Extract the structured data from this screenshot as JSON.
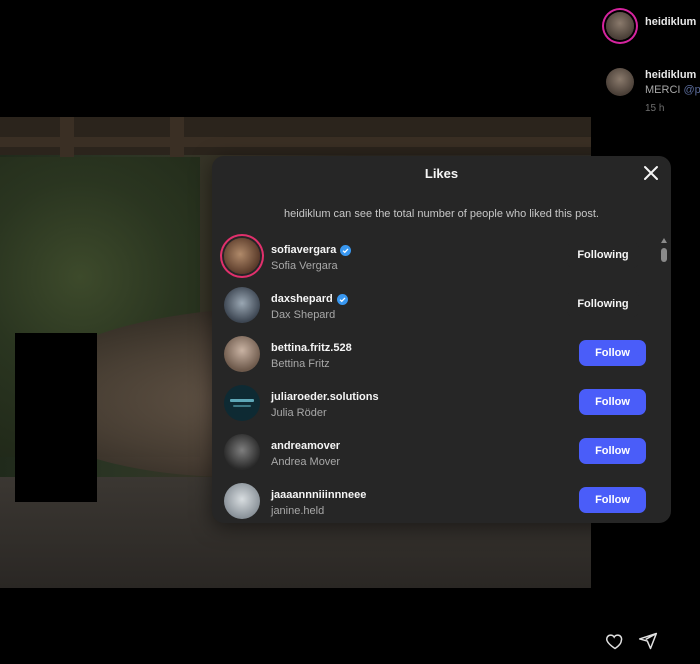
{
  "sidebar": {
    "top_username": "heidiklum",
    "comment_username": "heidiklum",
    "comment_text": "MERCI ",
    "comment_mention": "@p",
    "comment_time": "15 h",
    "icons": [
      "heart-icon",
      "share-icon"
    ]
  },
  "modal": {
    "title": "Likes",
    "notice": "heidiklum can see the total number of people who liked this post.",
    "users": [
      {
        "username": "sofiavergara",
        "fullname": "Sofia Vergara",
        "verified": true,
        "button": "Following",
        "story": true
      },
      {
        "username": "daxshepard",
        "fullname": "Dax Shepard",
        "verified": true,
        "button": "Following",
        "story": false
      },
      {
        "username": "bettina.fritz.528",
        "fullname": "Bettina Fritz",
        "verified": false,
        "button": "Follow",
        "story": false
      },
      {
        "username": "juliaroeder.solutions",
        "fullname": "Julia Röder",
        "verified": false,
        "button": "Follow",
        "story": false
      },
      {
        "username": "andreamover",
        "fullname": "Andrea Mover",
        "verified": false,
        "button": "Follow",
        "story": false
      },
      {
        "username": "jaaaannniiinnneee",
        "fullname": "janine.held",
        "verified": false,
        "button": "Follow",
        "story": false
      }
    ]
  },
  "colors": {
    "follow_blue": "#4a5df9",
    "verified_blue": "#3897f0",
    "modal_bg": "#262626"
  }
}
